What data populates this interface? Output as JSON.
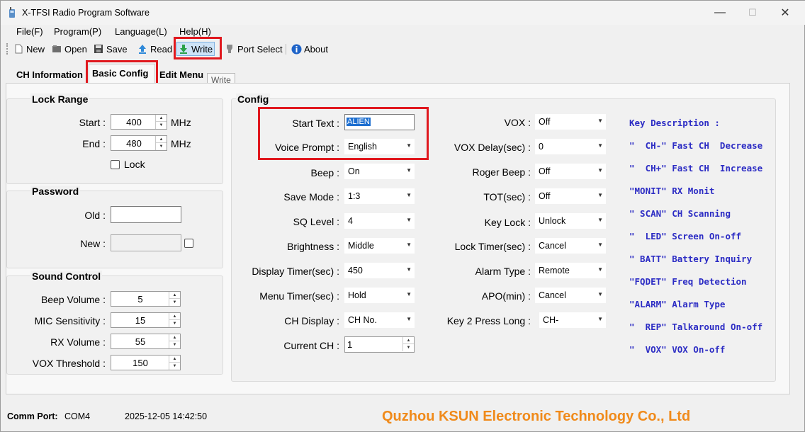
{
  "window": {
    "title": "X-TFSI Radio Program Software",
    "minimize": "—",
    "maximize": "☐",
    "close": "✕"
  },
  "menu": [
    "File(F)",
    "Program(P)",
    "Language(L)",
    "Help(H)"
  ],
  "toolbar": {
    "new": "New",
    "open": "Open",
    "save": "Save",
    "read": "Read",
    "write": "Write",
    "port_select": "Port Select",
    "about": "About",
    "tooltip": "Write"
  },
  "tabs": [
    "CH Information",
    "Basic Config",
    "Edit Menu"
  ],
  "lock_range": {
    "title": "Lock Range",
    "start_label": "Start :",
    "start_value": "400",
    "end_label": "End :",
    "end_value": "480",
    "unit": "MHz",
    "lock_label": "Lock"
  },
  "password": {
    "title": "Password",
    "old_label": "Old :",
    "new_label": "New :"
  },
  "sound": {
    "title": "Sound Control",
    "beep_volume_label": "Beep Volume :",
    "beep_volume": "5",
    "mic_label": "MIC Sensitivity :",
    "mic": "15",
    "rx_label": "RX Volume :",
    "rx": "55",
    "vox_label": "VOX Threshold :",
    "vox": "150"
  },
  "config": {
    "title": "Config",
    "start_text_label": "Start Text :",
    "start_text": "ALIEN",
    "voice_prompt_label": "Voice Prompt :",
    "voice_prompt": "English",
    "beep_label": "Beep :",
    "beep": "On",
    "save_mode_label": "Save Mode :",
    "save_mode": "1:3",
    "sq_label": "SQ Level :",
    "sq": "4",
    "brightness_label": "Brightness :",
    "brightness": "Middle",
    "display_timer_label": "Display Timer(sec) :",
    "display_timer": "450",
    "menu_timer_label": "Menu Timer(sec) :",
    "menu_timer": "Hold",
    "ch_display_label": "CH Display :",
    "ch_display": "CH No.",
    "current_ch_label": "Current CH :",
    "current_ch": "1",
    "vox_label": "VOX :",
    "vox": "Off",
    "vox_delay_label": "VOX Delay(sec) :",
    "vox_delay": "0",
    "roger_label": "Roger Beep :",
    "roger": "Off",
    "tot_label": "TOT(sec) :",
    "tot": "Off",
    "key_lock_label": "Key Lock :",
    "key_lock": "Unlock",
    "lock_timer_label": "Lock Timer(sec) :",
    "lock_timer": "Cancel",
    "alarm_type_label": "Alarm Type :",
    "alarm_type": "Remote",
    "apo_label": "APO(min) :",
    "apo": "Cancel",
    "key2_label": "Key 2 Press Long :",
    "key2": "CH-"
  },
  "key_description": {
    "title": "Key Description :",
    "lines": [
      "\"  CH-\" Fast CH  Decrease",
      "\"  CH+\" Fast CH  Increase",
      "\"MONIT\" RX Monit",
      "\" SCAN\" CH Scanning",
      "\"  LED\" Screen On-off",
      "\" BATT\" Battery Inquiry",
      "\"FQDET\" Freq Detection",
      "\"ALARM\" Alarm Type",
      "\"  REP\" Talkaround On-off",
      "\"  VOX\" VOX On-off"
    ]
  },
  "status": {
    "port_label": "Comm Port:",
    "port": "COM4",
    "datetime": "2025-12-05 14:42:50",
    "company": "Quzhou KSUN Electronic Technology Co., Ltd"
  },
  "colors": {
    "accent_red": "#e0181e",
    "key_desc_blue": "#2c2cc4",
    "company_orange": "#f08a1a"
  }
}
